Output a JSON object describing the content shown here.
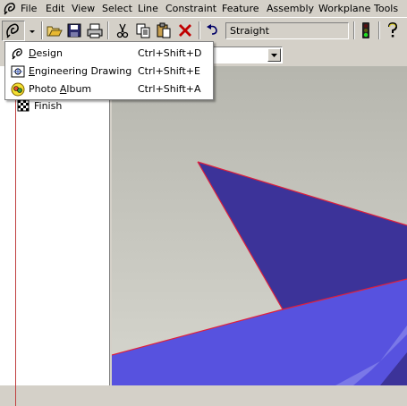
{
  "menubar": {
    "items": [
      "File",
      "Edit",
      "View",
      "Select",
      "Line",
      "Constraint",
      "Feature",
      "Assembly",
      "Workplane",
      "Tools"
    ]
  },
  "toolbar": {
    "line_type_value": "Straight",
    "buttons": [
      "mode-icon",
      "dropdown-arrow-icon",
      "open-folder-icon",
      "save-icon",
      "print-icon",
      "cut-icon",
      "copy-icon",
      "paste-icon",
      "delete-icon",
      "undo-icon",
      "traffic-light-icon",
      "help-icon"
    ]
  },
  "tree": {
    "items": [
      {
        "label": "Finish",
        "icon": "checkered-flag-icon"
      }
    ]
  },
  "mode_menu": {
    "items": [
      {
        "label_ul": "D",
        "label_rest": "esign",
        "shortcut": "Ctrl+Shift+D",
        "icon": "design-icon"
      },
      {
        "label_ul": "E",
        "label_rest": "ngineering Drawing",
        "shortcut": "Ctrl+Shift+E",
        "icon": "engineering-drawing-icon"
      },
      {
        "label_pre": "Photo ",
        "label_ul": "A",
        "label_rest": "lbum",
        "shortcut": "Ctrl+Shift+A",
        "icon": "photo-album-icon"
      }
    ]
  },
  "colors": {
    "window": "#d4d0c8",
    "viewport_bg": "#c2c2ba",
    "shape_dark": "#3c3399",
    "shape_light": "#5752df",
    "edge": "#e0203c"
  }
}
